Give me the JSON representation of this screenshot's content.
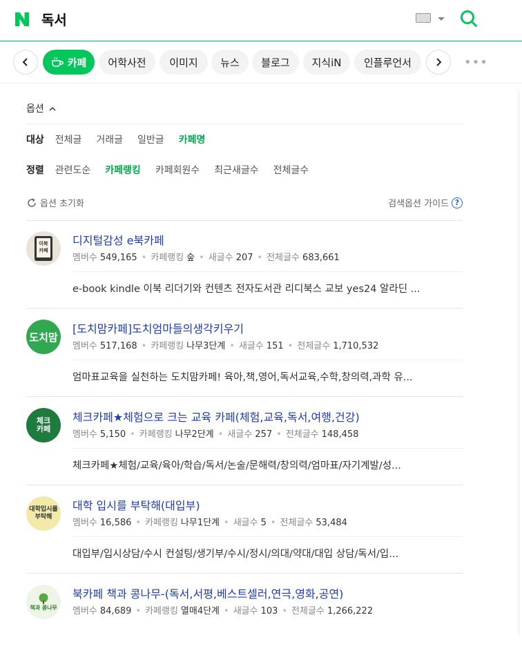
{
  "header": {
    "query": "독서",
    "logo": "N"
  },
  "tabs": [
    {
      "label": "카페",
      "active": true
    },
    {
      "label": "어학사전"
    },
    {
      "label": "이미지"
    },
    {
      "label": "뉴스"
    },
    {
      "label": "블로그"
    },
    {
      "label": "지식iN"
    },
    {
      "label": "인플루언서"
    }
  ],
  "options": {
    "title": "옵션",
    "target": {
      "label": "대상",
      "items": [
        "전체글",
        "거래글",
        "일반글",
        "카페명"
      ],
      "selected": "카페명"
    },
    "sort": {
      "label": "정렬",
      "items": [
        "관련도순",
        "카페랭킹",
        "카페회원수",
        "최근새글수",
        "전체글수"
      ],
      "selected": "카페랭킹"
    },
    "reset": "옵션 초기화",
    "guide": "검색옵션 가이드",
    "guide_icon": "?"
  },
  "meta_labels": {
    "members": "멤버수",
    "ranking": "카페랭킹",
    "new_posts": "새글수",
    "total_posts": "전체글수"
  },
  "results": [
    {
      "title": "디지털감성 e북카페",
      "thumb_text": "이북\n카페",
      "members": "549,165",
      "ranking": "숲",
      "new_posts": "207",
      "total_posts": "683,661",
      "description": "e-book kindle 이북 리더기와 컨텐츠 전자도서관 리디북스 교보 yes24 알라딘 ..."
    },
    {
      "title": "[도치맘카페]도치엄마들의생각키우기",
      "thumb_text": "도치맘",
      "members": "517,168",
      "ranking": "나무3단계",
      "new_posts": "151",
      "total_posts": "1,710,532",
      "description": "엄마표교육을 실천하는 도치맘카페! 육아,책,영어,독서교육,수학,창의력,과학 유..."
    },
    {
      "title": "체크카페★체험으로 크는 교육 카페(체험,교육,독서,여행,건강)",
      "thumb_text": "체크\n카페",
      "members": "5,150",
      "ranking": "나무2단계",
      "new_posts": "257",
      "total_posts": "148,458",
      "description": "체크카페★체험/교육/육아/학습/독서/논술/문해력/창의력/엄마표/자기계발/성..."
    },
    {
      "title": "대학 입시를 부탁해(대입부)",
      "thumb_text": "대학입시를\n부탁해",
      "members": "16,586",
      "ranking": "나무1단계",
      "new_posts": "5",
      "total_posts": "53,484",
      "description": "대입부/입시상담/수시 컨설팅/생기부/수시/정시/의대/약대/대입 상담/독서/입..."
    },
    {
      "title": "북카페 책과 콩나무-(독서,서평,베스트셀러,연극,영화,공연)",
      "thumb_text": "책과 콩나무",
      "members": "84,689",
      "ranking": "열매4단계",
      "new_posts": "103",
      "total_posts": "1,266,222",
      "description": ""
    }
  ],
  "colors": {
    "brand": "#03c75a",
    "link": "#1c3bb5"
  }
}
